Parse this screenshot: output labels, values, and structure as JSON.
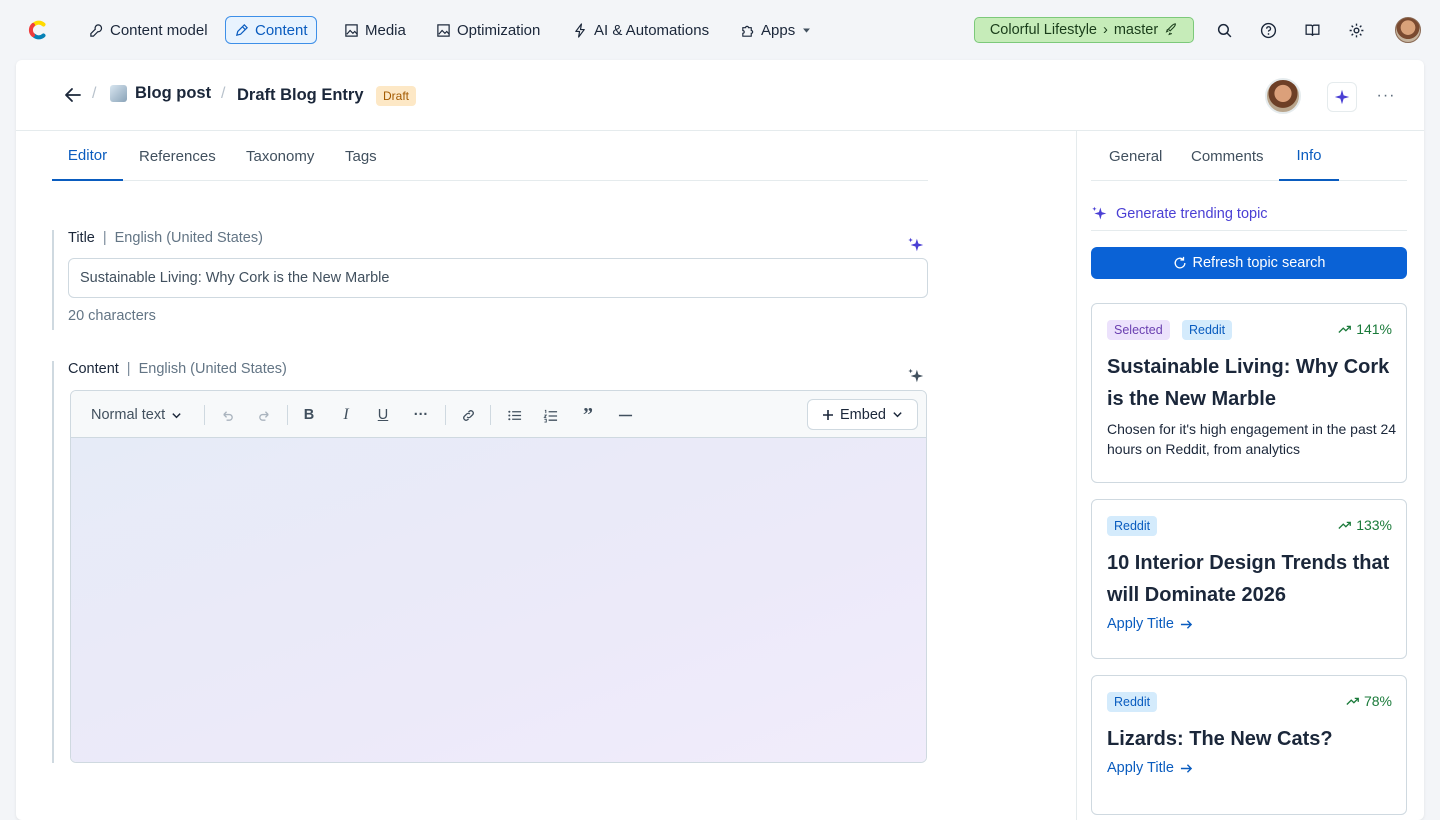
{
  "nav": {
    "items": [
      {
        "label": "Content model",
        "icon": "wrench-icon"
      },
      {
        "label": "Content",
        "icon": "pen-icon"
      },
      {
        "label": "Media",
        "icon": "image-icon"
      },
      {
        "label": "Optimization",
        "icon": "image-icon"
      },
      {
        "label": "AI & Automations",
        "icon": "bolt-icon"
      },
      {
        "label": "Apps",
        "icon": "puzzle-icon"
      }
    ],
    "active": "Content",
    "space": "Colorful Lifestyle",
    "environment": "master"
  },
  "header": {
    "content_type": "Blog post",
    "entry_title": "Draft Blog Entry",
    "status": "Draft"
  },
  "editor_tabs": [
    "Editor",
    "References",
    "Taxonomy",
    "Tags"
  ],
  "fields": {
    "title": {
      "label": "Title",
      "locale": "English (United States)",
      "value": "Sustainable Living: Why Cork is the New Marble",
      "char_count": "20 characters"
    },
    "content": {
      "label": "Content",
      "locale": "English (United States)",
      "format_select": "Normal text",
      "embed_label": "Embed"
    }
  },
  "sidebar": {
    "tabs": [
      "General",
      "Comments",
      "Info"
    ],
    "active_tab": "Info",
    "generate_label": "Generate trending topic",
    "refresh_label": "Refresh topic search",
    "topics": [
      {
        "tags": [
          "Selected",
          "Reddit"
        ],
        "trend": "141%",
        "title": "Sustainable Living: Why Cork is the New Marble",
        "description": "Chosen for it's high engagement in the past 24 hours on Reddit, from analytics"
      },
      {
        "tags": [
          "Reddit"
        ],
        "trend": "133%",
        "title": "10 Interior Design Trends that will Dominate 2026",
        "action": "Apply Title"
      },
      {
        "tags": [
          "Reddit"
        ],
        "trend": "78%",
        "title": "Lizards: The New Cats?",
        "action": "Apply Title"
      }
    ]
  },
  "colors": {
    "accent": "#0a5cbf",
    "primary_button": "#0a62d6",
    "env_pill": "#c6ecb9",
    "ai_purple": "#4a3fd4"
  }
}
